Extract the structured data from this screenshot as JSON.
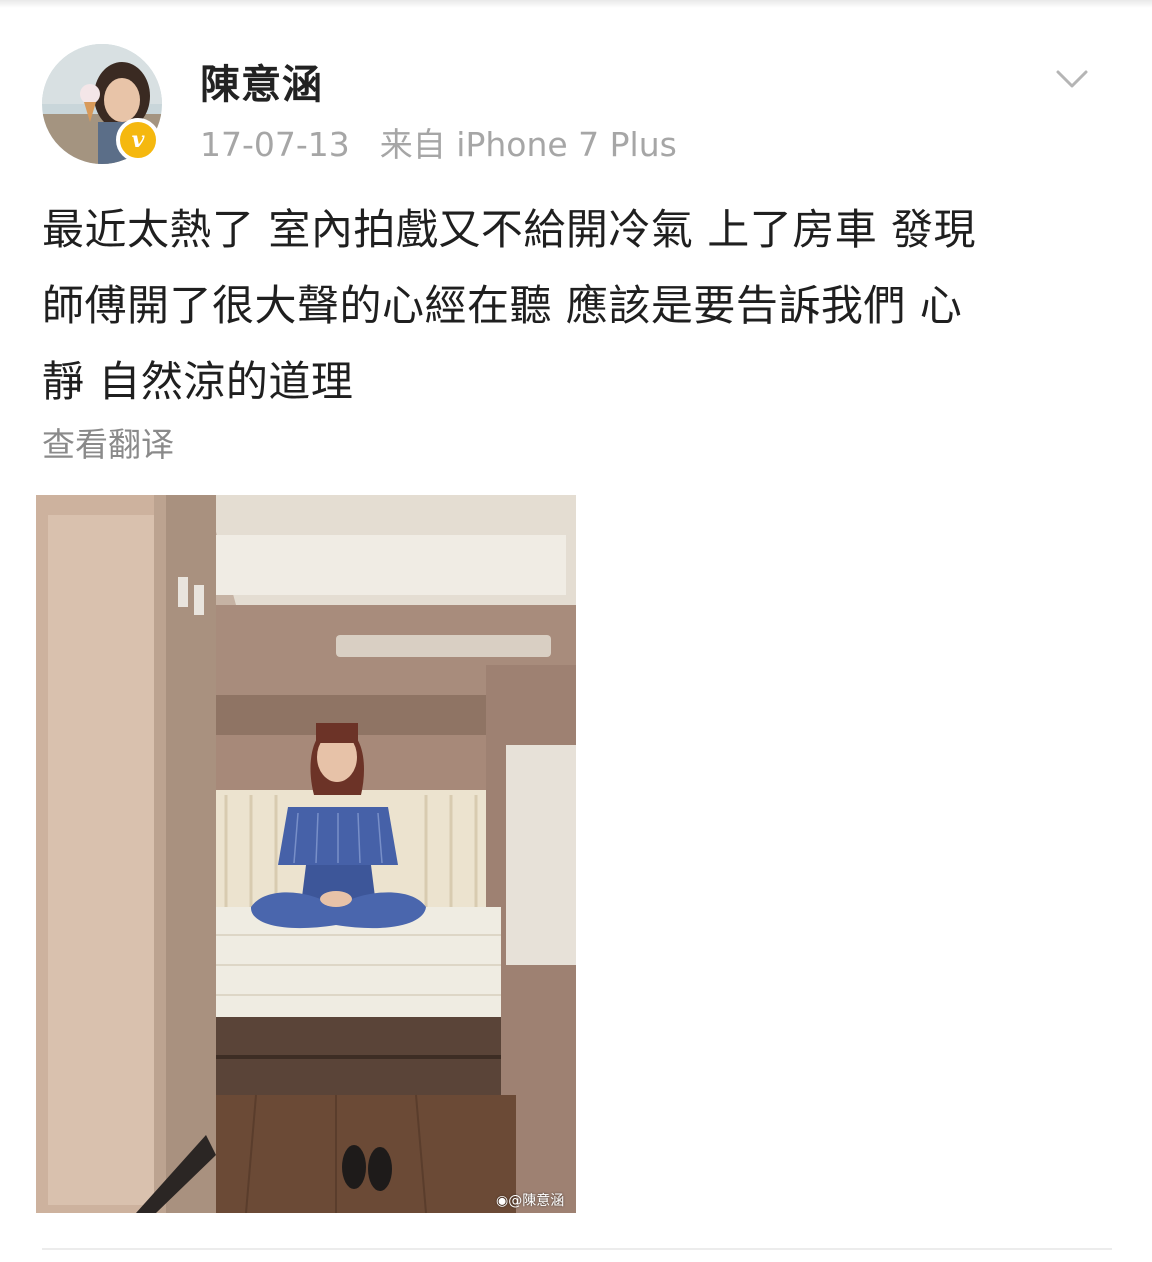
{
  "post": {
    "author": "陳意涵",
    "date": "17-07-13",
    "source": "来自 iPhone 7 Plus",
    "text": "最近太熱了 室內拍戲又不給開冷氣 上了房車 發現\n師傅開了很大聲的心經在聽 應該是要告訴我們 心\n靜 自然涼的道理",
    "translate_label": "查看翻译",
    "image_watermark": "@陳意涵"
  },
  "icons": {
    "verified": "verified-v-icon",
    "more": "chevron-down-icon",
    "weibo": "weibo-logo-icon"
  },
  "colors": {
    "verified_badge": "#f5b80f",
    "name": "#222222",
    "meta": "#a6a6a6",
    "body_text": "#1f1f1f",
    "translate": "#8a8a8a"
  }
}
